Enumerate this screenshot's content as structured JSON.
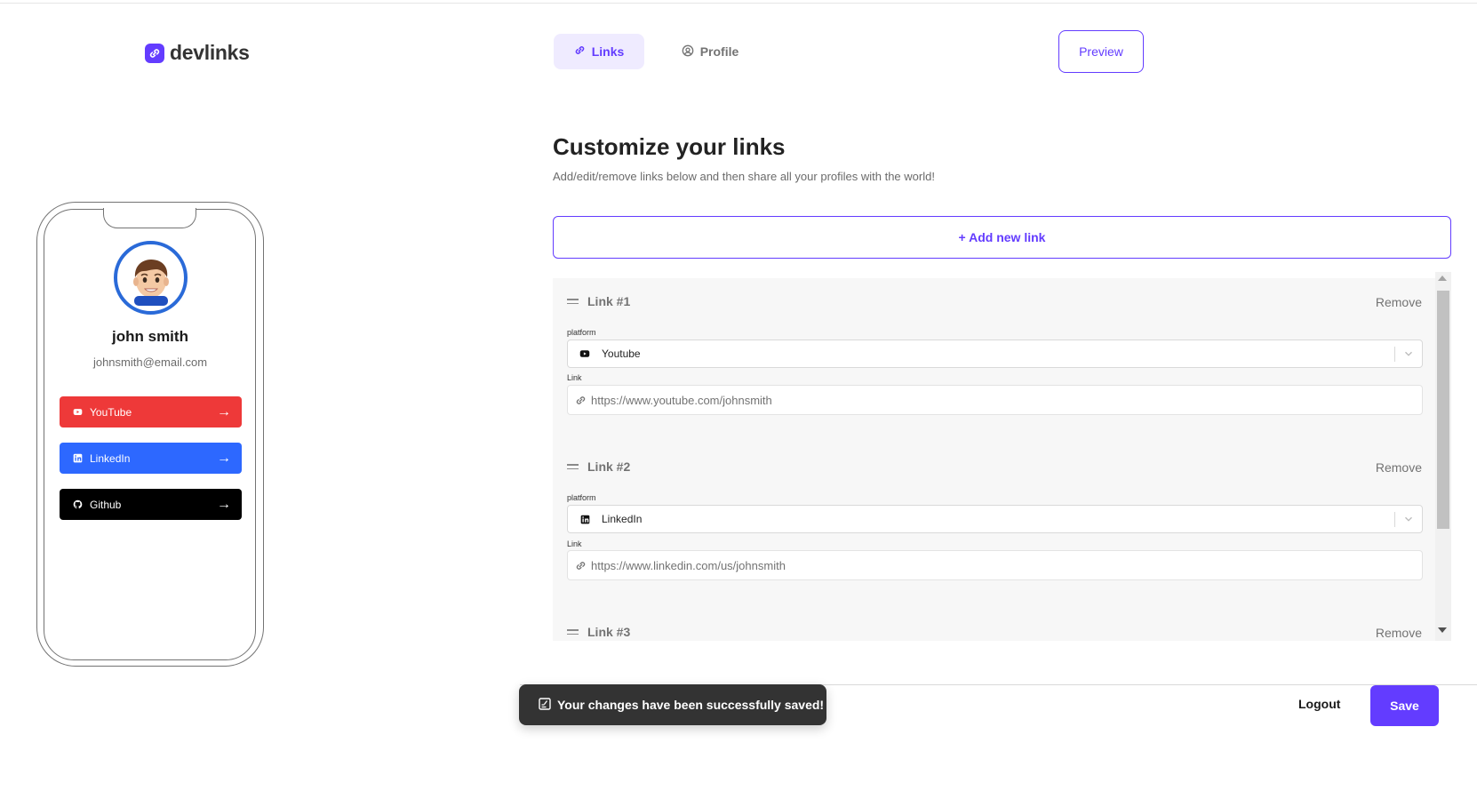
{
  "brand": {
    "name": "devlinks",
    "accent": "#633cff"
  },
  "nav": {
    "tabs": [
      {
        "label": "Links",
        "icon": "link-icon",
        "active": true
      },
      {
        "label": "Profile",
        "icon": "profile-circle-icon",
        "active": false
      }
    ],
    "preview_label": "Preview"
  },
  "phone_preview": {
    "name": "john smith",
    "email": "johnsmith@email.com",
    "links": [
      {
        "label": "YouTube",
        "color": "#ee3939",
        "icon": "youtube-icon"
      },
      {
        "label": "LinkedIn",
        "color": "#2d68ff",
        "icon": "linkedin-icon"
      },
      {
        "label": "Github",
        "color": "#000000",
        "icon": "github-icon"
      }
    ]
  },
  "main": {
    "title": "Customize your links",
    "subtitle": "Add/edit/remove links below and then share all your profiles with the world!",
    "add_button": "+ Add new link",
    "links": [
      {
        "title": "Link #1",
        "remove": "Remove",
        "platform_label": "platform",
        "platform": "Youtube",
        "platform_icon": "youtube-icon",
        "link_label": "Link",
        "url": "https://www.youtube.com/johnsmith"
      },
      {
        "title": "Link #2",
        "remove": "Remove",
        "platform_label": "platform",
        "platform": "LinkedIn",
        "platform_icon": "linkedin-icon",
        "link_label": "Link",
        "url": "https://www.linkedin.com/us/johnsmith"
      },
      {
        "title": "Link #3",
        "remove": "Remove"
      }
    ]
  },
  "footer": {
    "toast": "Your changes have been successfully saved!",
    "logout_label": "Logout",
    "save_label": "Save"
  }
}
